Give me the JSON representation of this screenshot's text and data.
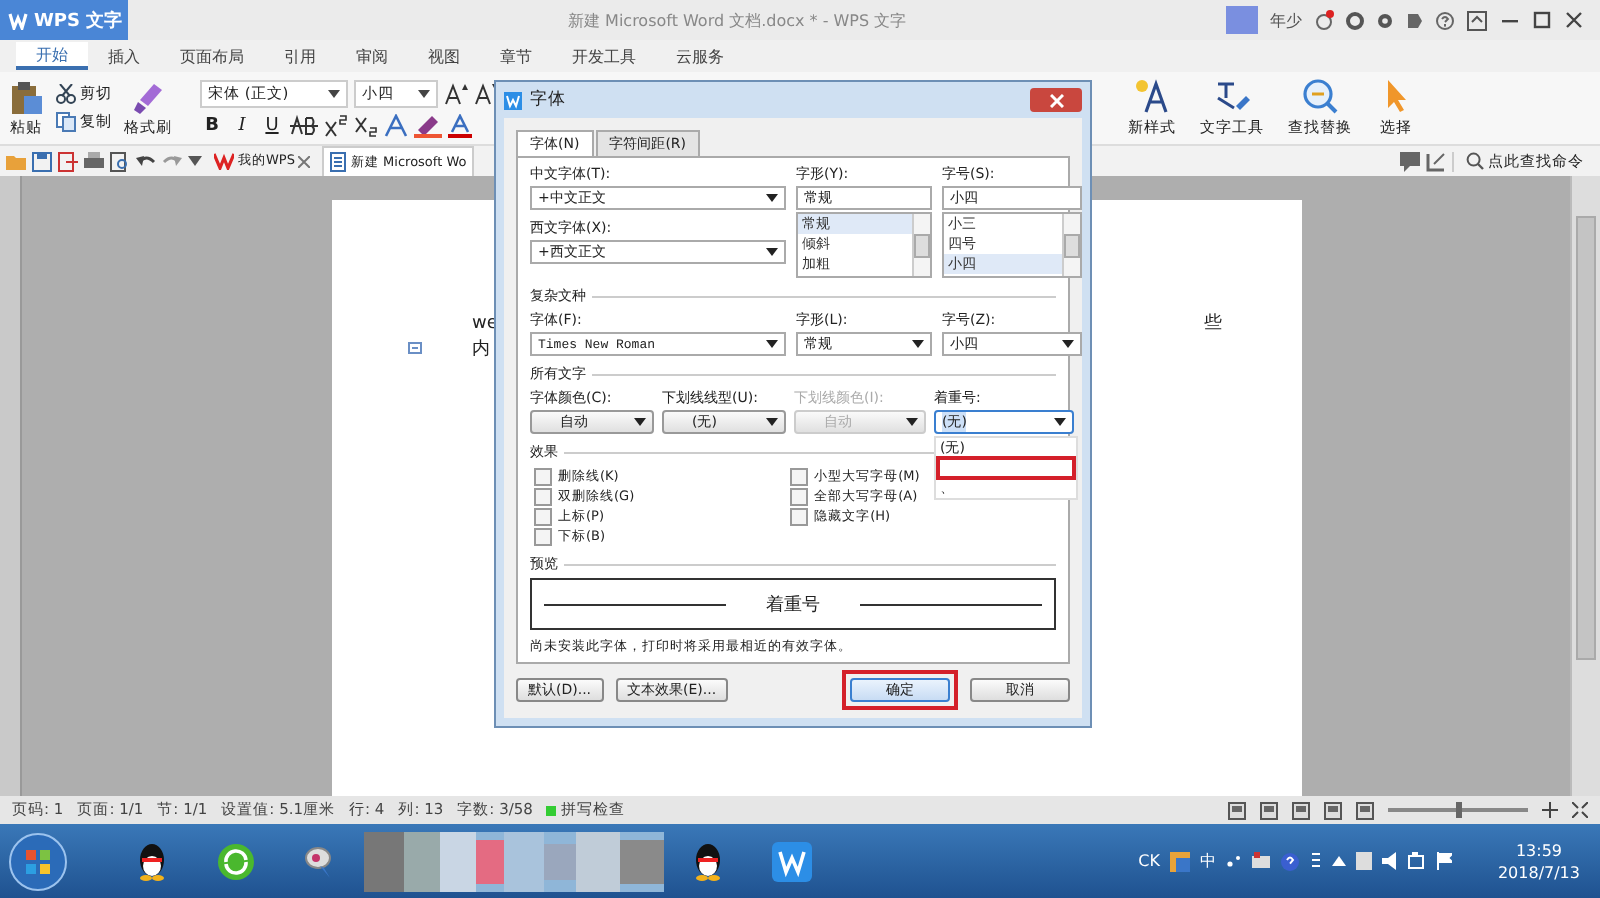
{
  "app": {
    "menu_label": "WPS 文字",
    "title": "新建 Microsoft Word 文档.docx * - WPS 文字",
    "user": "年少"
  },
  "menu_tabs": [
    {
      "label": "开始",
      "selected": true
    },
    {
      "label": "插入",
      "selected": false
    },
    {
      "label": "页面布局",
      "selected": false
    },
    {
      "label": "引用",
      "selected": false
    },
    {
      "label": "审阅",
      "selected": false
    },
    {
      "label": "视图",
      "selected": false
    },
    {
      "label": "章节",
      "selected": false
    },
    {
      "label": "开发工具",
      "selected": false
    },
    {
      "label": "云服务",
      "selected": false
    }
  ],
  "ribbon": {
    "paste": "粘贴",
    "cut": "剪切",
    "copy": "复制",
    "painter": "格式刷",
    "font": "宋体 (正文)",
    "size": "小四",
    "bold": "B",
    "italic": "I",
    "underline": "U",
    "tools": [
      {
        "label": "新样式",
        "kind": "style"
      },
      {
        "label": "文字工具",
        "kind": "text"
      },
      {
        "label": "查找替换",
        "kind": "find"
      },
      {
        "label": "选择",
        "kind": "select"
      }
    ]
  },
  "doc_tabs": [
    {
      "label": "我的WPS",
      "selected": false
    },
    {
      "label": "新建 Microsoft Wo",
      "selected": true
    }
  ],
  "command_search": "点此查找命令",
  "document": {
    "line_1": "we",
    "line_2": "内",
    "side_text": "些"
  },
  "dialog": {
    "title": "字体",
    "tabs": [
      {
        "label": "字体(N)",
        "selected": true
      },
      {
        "label": "字符间距(R)",
        "selected": false
      }
    ],
    "chinese_font": {
      "label": "中文字体(T):",
      "value": "+中文正文"
    },
    "western_font": {
      "label": "西文字体(X):",
      "value": "+西文正文"
    },
    "style": {
      "label": "字形(Y):",
      "value": "常规",
      "options": [
        {
          "label": "常规",
          "selected": true
        },
        {
          "label": "倾斜",
          "selected": false
        },
        {
          "label": "加粗",
          "selected": false
        }
      ]
    },
    "size": {
      "label": "字号(S):",
      "value": "小四",
      "options": [
        {
          "label": "小三",
          "selected": false
        },
        {
          "label": "四号",
          "selected": false
        },
        {
          "label": "小四",
          "selected": true
        }
      ]
    },
    "complex_section": "复杂文种",
    "complex_font": {
      "label": "字体(F):",
      "value": "Times New Roman"
    },
    "complex_style": {
      "label": "字形(L):",
      "value": "常规"
    },
    "complex_size": {
      "label": "字号(Z):",
      "value": "小四"
    },
    "all_section": "所有文字",
    "combos": [
      {
        "label": "字体颜色(C):",
        "value": "自动",
        "disabled": false
      },
      {
        "label": "下划线线型(U):",
        "value": "(无)",
        "disabled": false
      },
      {
        "label": "下划线颜色(I):",
        "value": "自动",
        "disabled": true
      },
      {
        "label": "着重号:",
        "value": "(无)",
        "disabled": false
      }
    ],
    "emphasis_options": [
      {
        "kind": "text",
        "label": "(无)",
        "highlighted": false
      },
      {
        "kind": "blank",
        "highlighted": true
      },
      {
        "kind": "text",
        "label": "、",
        "highlighted": false
      }
    ],
    "effects_section": "效果",
    "effects_left": [
      {
        "label": "删除线(K)",
        "checked": false
      },
      {
        "label": "双删除线(G)",
        "checked": false
      },
      {
        "label": "上标(P)",
        "checked": false
      },
      {
        "label": "下标(B)",
        "checked": false
      }
    ],
    "effects_right": [
      {
        "label": "小型大写字母(M)",
        "checked": false
      },
      {
        "label": "全部大写字母(A)",
        "checked": false
      },
      {
        "label": "隐藏文字(H)",
        "checked": false
      }
    ],
    "preview_section": "预览",
    "preview_text": "着重号",
    "note": "尚未安装此字体，打印时将采用最相近的有效字体。",
    "buttons": [
      {
        "label": "默认(D)...",
        "kind": "left",
        "highlighted": false
      },
      {
        "label": "文本效果(E)...",
        "kind": "left",
        "highlighted": false
      },
      {
        "label": "确定",
        "kind": "primary",
        "highlighted": true
      },
      {
        "label": "取消",
        "kind": "right",
        "highlighted": false
      }
    ]
  },
  "status_bar": [
    "页码: 1",
    "页面: 1/1",
    "节: 1/1",
    "设置值: 5.1厘米",
    "行: 4",
    "列: 13",
    "字数: 3/58",
    "拼写检查"
  ],
  "zoom_slider": {
    "level": 0.5
  },
  "taskbar": {
    "apps": [
      {
        "kind": "penguin"
      },
      {
        "kind": "refresh"
      },
      {
        "kind": "bird"
      },
      {
        "kind": "picture"
      },
      {
        "kind": "penguin"
      },
      {
        "kind": "wps"
      }
    ],
    "tray": [
      "CK",
      "中"
    ],
    "time": "13:59",
    "date": "2018/7/13"
  }
}
